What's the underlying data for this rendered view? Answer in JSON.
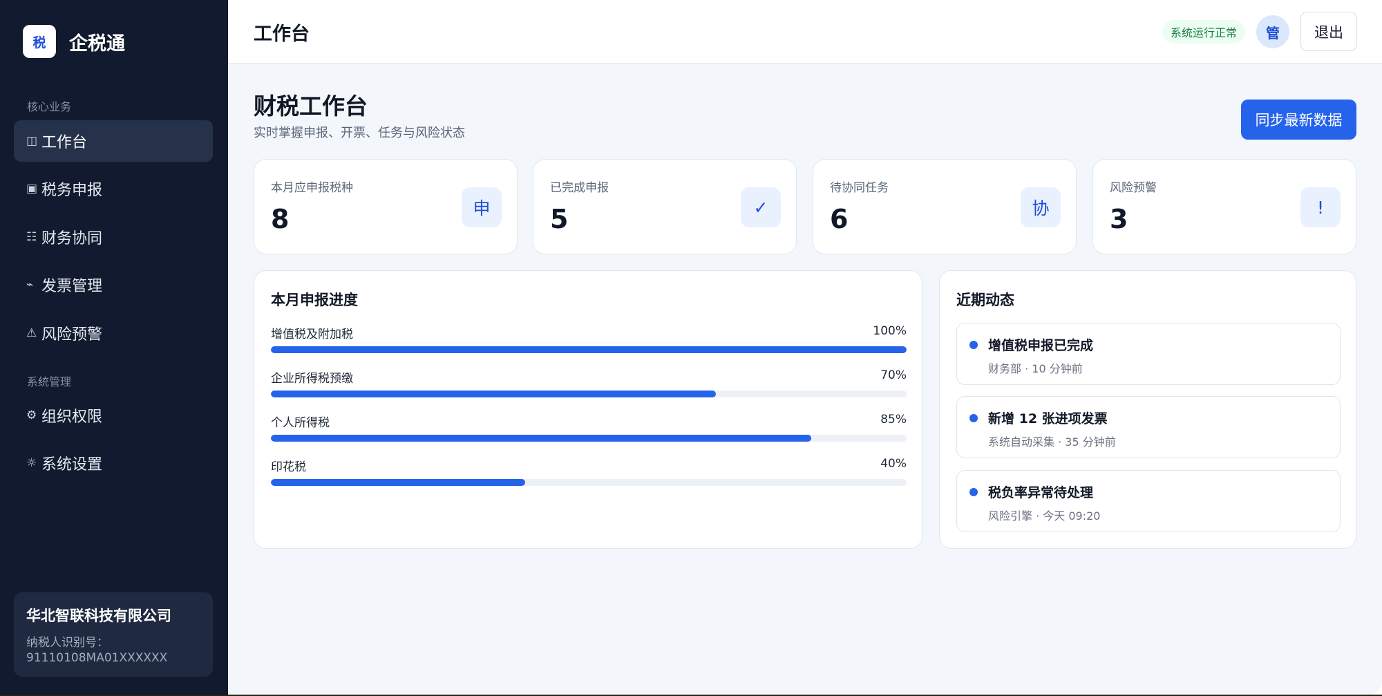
{
  "brand": {
    "logo_text": "税",
    "name": "企税通"
  },
  "sidebar": {
    "section_core": "核心业务",
    "section_system": "系统管理",
    "items": [
      {
        "label": "工作台",
        "icon": "◫",
        "icon_name": "dashboard-icon",
        "active": true
      },
      {
        "label": "税务申报",
        "icon": "▣",
        "icon_name": "tax-filing-icon"
      },
      {
        "label": "财务协同",
        "icon": "☷",
        "icon_name": "collaboration-icon"
      },
      {
        "label": "发票管理",
        "icon": "⌁",
        "icon_name": "invoice-icon"
      },
      {
        "label": "风险预警",
        "icon": "⚠",
        "icon_name": "warning-icon"
      },
      {
        "label": "组织权限",
        "icon": "⚙",
        "icon_name": "org-permissions-icon"
      },
      {
        "label": "系统设置",
        "icon": "☼",
        "icon_name": "settings-icon"
      }
    ],
    "company": {
      "name": "华北智联科技有限公司",
      "tax_label": "纳税人识别号：",
      "tax_id": "91110108MA01XXXXXX"
    }
  },
  "topbar": {
    "title": "工作台",
    "status": "系统运行正常",
    "avatar": "管",
    "logout": "退出"
  },
  "header": {
    "title": "财税工作台",
    "subtitle": "实时掌握申报、开票、任务与风险状态",
    "sync_button": "同步最新数据"
  },
  "stats": [
    {
      "label": "本月应申报税种",
      "value": "8",
      "icon": "申"
    },
    {
      "label": "已完成申报",
      "value": "5",
      "icon": "✓"
    },
    {
      "label": "待协同任务",
      "value": "6",
      "icon": "协"
    },
    {
      "label": "风险预警",
      "value": "3",
      "icon": "!"
    }
  ],
  "progress": {
    "title": "本月申报进度",
    "items": [
      {
        "label": "增值税及附加税",
        "percent": 100,
        "percent_label": "100%"
      },
      {
        "label": "企业所得税预缴",
        "percent": 70,
        "percent_label": "70%"
      },
      {
        "label": "个人所得税",
        "percent": 85,
        "percent_label": "85%"
      },
      {
        "label": "印花税",
        "percent": 40,
        "percent_label": "40%"
      }
    ]
  },
  "activity": {
    "title": "近期动态",
    "items": [
      {
        "title": "增值税申报已完成",
        "meta": "财务部 · 10 分钟前"
      },
      {
        "title": "新增 12 张进项发票",
        "meta": "系统自动采集 · 35 分钟前"
      },
      {
        "title": "税负率异常待处理",
        "meta": "风险引擎 · 今天 09:20"
      }
    ]
  },
  "colors": {
    "sidebar_bg": "#111a2e",
    "accent": "#2563eb",
    "main_bg": "#f3f6fa",
    "status_green": "#15803d"
  }
}
